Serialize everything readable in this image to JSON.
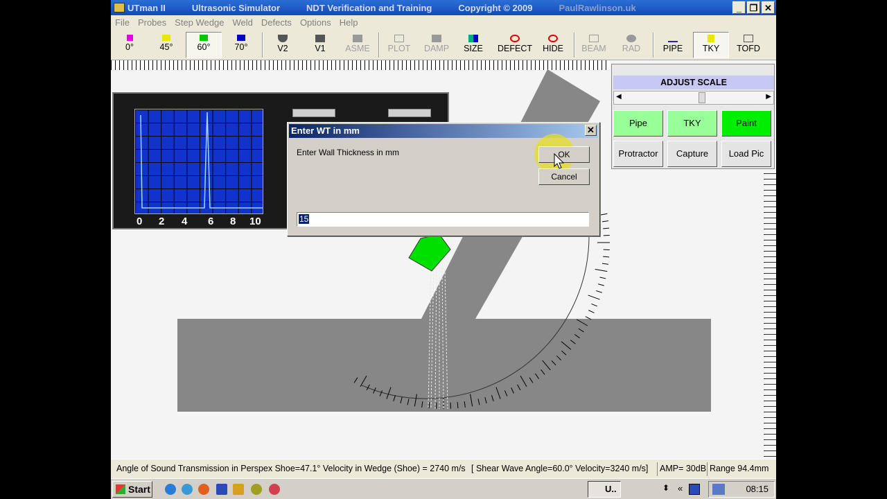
{
  "titlebar": {
    "app_name": "UTman II",
    "subtitle1": "Ultrasonic Simulator",
    "subtitle2": "NDT Verification and Training",
    "copyright": "Copyright © 2009",
    "watermark": "PaulRawlinson.uk"
  },
  "menu": [
    "File",
    "Probes",
    "Step Wedge",
    "Weld",
    "Defects",
    "Options",
    "Help"
  ],
  "toolbar": [
    {
      "label": "0°",
      "icon_color": "#e800e8",
      "state": "normal"
    },
    {
      "label": "45°",
      "icon_color": "#e8e800",
      "state": "normal"
    },
    {
      "label": "60°",
      "icon_color": "#00c800",
      "state": "pressed"
    },
    {
      "label": "70°",
      "icon_color": "#0000c8",
      "state": "normal"
    },
    {
      "label": "V2",
      "icon": "v2-block-icon",
      "state": "normal"
    },
    {
      "label": "V1",
      "icon": "v1-block-icon",
      "state": "normal"
    },
    {
      "label": "ASME",
      "icon": "asme-block-icon",
      "state": "disabled"
    },
    {
      "label": "PLOT",
      "icon": "plot-icon",
      "state": "disabled"
    },
    {
      "label": "DAMP",
      "icon": "damp-icon",
      "state": "disabled"
    },
    {
      "label": "SIZE",
      "icon": "size-icon",
      "state": "normal"
    },
    {
      "label": "DEFECT",
      "icon": "defect-icon",
      "state": "normal"
    },
    {
      "label": "HIDE",
      "icon": "hide-icon",
      "state": "normal"
    },
    {
      "label": "BEAM",
      "icon": "beam-icon",
      "state": "disabled"
    },
    {
      "label": "RAD",
      "icon": "rad-icon",
      "state": "disabled"
    },
    {
      "label": "PIPE",
      "icon": "pipe-icon",
      "state": "normal"
    },
    {
      "label": "TKY",
      "icon": "tky-icon",
      "state": "pressed"
    },
    {
      "label": "TOFD",
      "icon": "tofd-icon",
      "state": "normal"
    }
  ],
  "scope": {
    "ticks": [
      "0",
      "2",
      "4",
      "6",
      "8",
      "10"
    ],
    "screen_color": "#1133cc",
    "trace_color": "#9fd8ff"
  },
  "adjust_panel": {
    "title": "ADJUST SCALE",
    "scroll_position": 0.54,
    "buttons": [
      {
        "label": "Pipe",
        "color": "#99ff99"
      },
      {
        "label": "TKY",
        "color": "#99ff99"
      },
      {
        "label": "Paint",
        "color": "#00ee00"
      },
      {
        "label": "Protractor",
        "color": "#e4e4e4"
      },
      {
        "label": "Capture",
        "color": "#e4e4e4"
      },
      {
        "label": "Load Pic",
        "color": "#e4e4e4"
      }
    ]
  },
  "dialog": {
    "title": "Enter WT in mm",
    "prompt": "Enter Wall Thickness in mm",
    "ok_label": "OK",
    "cancel_label": "Cancel",
    "input_value": "15"
  },
  "statusbar": {
    "transmission": "Angle of Sound Transmission in Perspex Shoe=47.1°  Velocity in Wedge (Shoe) = 2740 m/s",
    "shear": "[ Shear Wave Angle=60.0°   Velocity=3240 m/s]",
    "amp": "AMP= 30dB",
    "range": "Range 94.4mm"
  },
  "taskbar": {
    "start_label": "Start",
    "task_label": "U..",
    "clock": "08:15"
  },
  "colors": {
    "probe": "#00e000",
    "plate": "#878787",
    "dialog_bg": "#d4d0c8",
    "ok_highlight": "#e6dc28"
  }
}
